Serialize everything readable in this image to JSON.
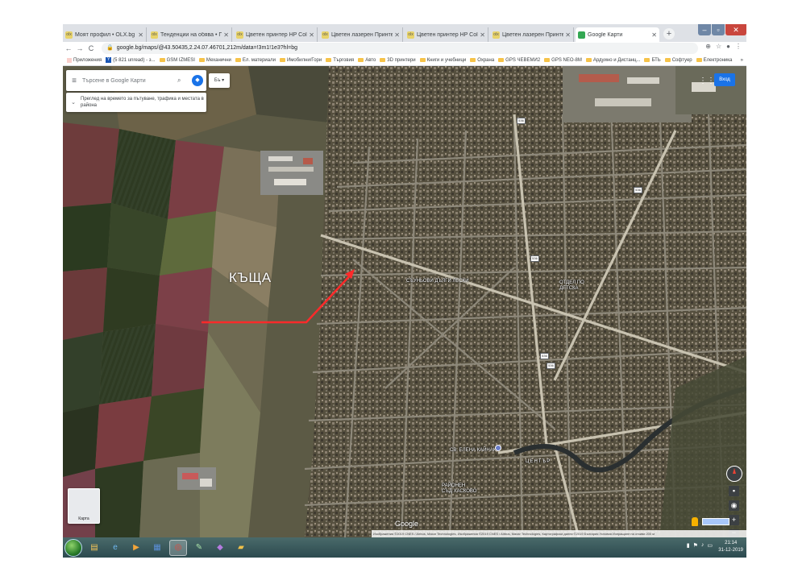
{
  "browser": {
    "tabs": [
      {
        "label": "Моят профил • OLX.bg",
        "favicon": "olx-icon",
        "active": false
      },
      {
        "label": "Тенденции на обява • Продажба",
        "favicon": "olx-icon",
        "active": false
      },
      {
        "label": "Цветен принтер HP Color Laser",
        "favicon": "olx-icon",
        "active": false
      },
      {
        "label": "Цветен лазерен Принтер гр. Ш",
        "favicon": "olx-icon",
        "active": false
      },
      {
        "label": "Цветен принтер HP Color Laser",
        "favicon": "olx-icon",
        "active": false
      },
      {
        "label": "Цветен лазерен Принтер гр. Ш",
        "favicon": "olx-icon",
        "active": false
      },
      {
        "label": "Google Карти",
        "favicon": "google-maps-icon",
        "active": true
      }
    ],
    "url": "google.bg/maps/@43.50435,2.24.07.46701,212m/data=!3m1!1e3?hl=bg",
    "bookmarks": [
      {
        "label": "Приложения",
        "icon": "apps-icon"
      },
      {
        "label": "(5 821 unread) - з...",
        "icon": "yahoo-icon"
      },
      {
        "label": "GSM IZMESI",
        "icon": "folder-icon"
      },
      {
        "label": "Механични",
        "icon": "folder-icon"
      },
      {
        "label": "Ел. материали",
        "icon": "folder-icon"
      },
      {
        "label": "Имобилни/Гори",
        "icon": "folder-icon"
      },
      {
        "label": "Търговия",
        "icon": "folder-icon"
      },
      {
        "label": "Авто",
        "icon": "folder-icon"
      },
      {
        "label": "3D принтери",
        "icon": "folder-icon"
      },
      {
        "label": "Книги и учебници",
        "icon": "folder-icon"
      },
      {
        "label": "Охрана",
        "icon": "folder-icon"
      },
      {
        "label": "GPS ЧЕВЕМИ2",
        "icon": "folder-icon"
      },
      {
        "label": "GPS NEO-8M",
        "icon": "folder-icon"
      },
      {
        "label": "Ардуино и Дистанц...",
        "icon": "folder-icon"
      },
      {
        "label": "БТЬ",
        "icon": "folder-icon"
      },
      {
        "label": "Софтуер",
        "icon": "folder-icon"
      },
      {
        "label": "Електроника",
        "icon": "folder-icon"
      }
    ]
  },
  "map": {
    "search_placeholder": "Търсене в Google Карти",
    "language_button": "Бъ",
    "hint_text": "Преглед на времето за пътуване, трафика и местата в района",
    "signin_label": "Вход",
    "annotation_label": "КЪЩА",
    "annotation_color": "#ff2a2a",
    "layers_label": "Карта",
    "google_logo": "Google",
    "attribution": "Изображения ©2019 CNES / Airbus, Maxar Technologies, Изображения ©2019 CNES / Airbus, Maxar Technologies, Картографски данни ©2019   България   Условия   Изпращане на отзиви   200 м",
    "places": [
      {
        "label": "СЪУНЬОВИ ДЪЛГИ ЛЕСКИ"
      },
      {
        "label": "ОТДЕЛ ПО\nДЕТСКА"
      },
      {
        "label": "СВ. ЕЛЕНА КАЙНАК"
      },
      {
        "label": "ЦЕНТЪР"
      },
      {
        "label": "РАЙОНЕН\nСЪД ХАСКОВО"
      }
    ],
    "route_shields": [
      "536",
      "536",
      "536",
      "536",
      "536"
    ]
  },
  "taskbar": {
    "apps": [
      "explorer-icon",
      "ie-icon",
      "media-player-icon",
      "word-icon",
      "chrome-icon",
      "notepad-icon",
      "vs-icon",
      "folder-icon"
    ],
    "time": "21:14",
    "date": "31-12-2019"
  }
}
